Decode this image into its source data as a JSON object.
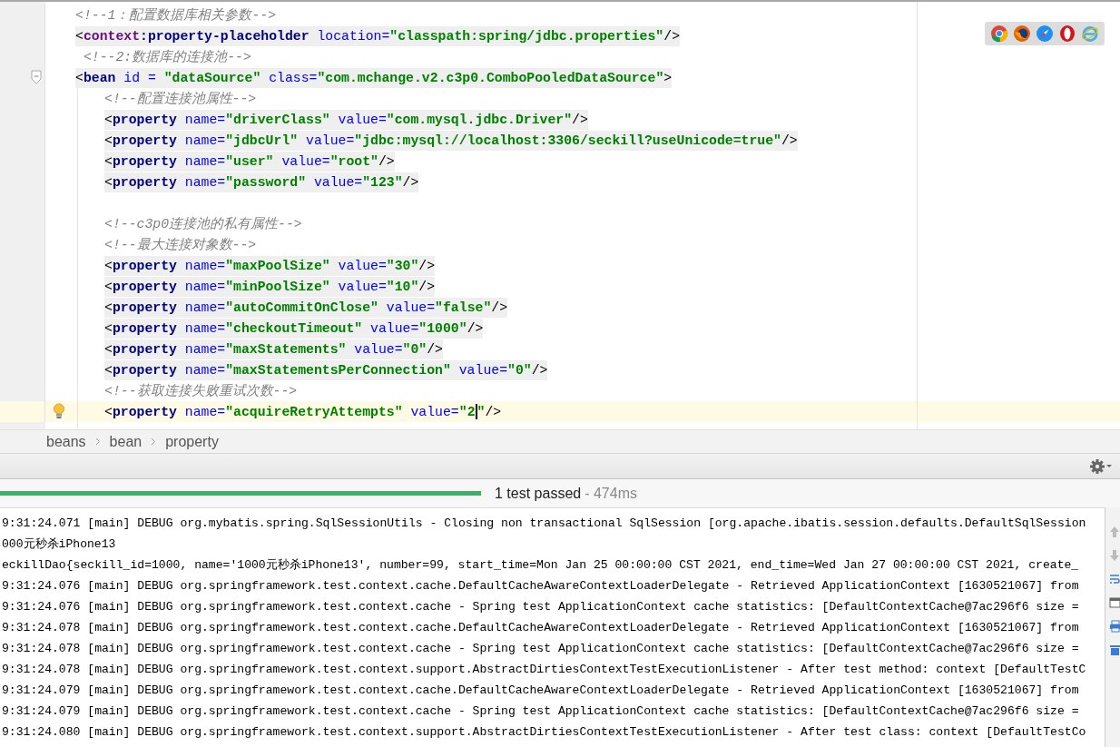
{
  "editor": {
    "lines": [
      {
        "kind": "comment",
        "tokens": [
          {
            "kind": "comment",
            "text": "<!--1：配置数据库相关参数-->"
          }
        ]
      },
      {
        "kind": "tag",
        "tokens": [
          {
            "kind": "punct",
            "text": "<"
          },
          {
            "kind": "ns",
            "text": "context"
          },
          {
            "kind": "tag",
            "text": ":property-placeholder"
          },
          {
            "kind": "attr",
            "text": " location="
          },
          {
            "kind": "value",
            "text": "\"classpath:spring/jdbc.properties\""
          },
          {
            "kind": "punct",
            "text": "/>"
          }
        ]
      },
      {
        "kind": "comment",
        "tokens": [
          {
            "kind": "comment",
            "text": " <!--2:数据库的连接池-->"
          }
        ]
      },
      {
        "kind": "tag",
        "tokens": [
          {
            "kind": "punct",
            "text": "<"
          },
          {
            "kind": "tag",
            "text": "bean"
          },
          {
            "kind": "attr",
            "text": " id = "
          },
          {
            "kind": "value",
            "text": "\"dataSource\""
          },
          {
            "kind": "attr",
            "text": " class="
          },
          {
            "kind": "value",
            "text": "\"com.mchange.v2.c3p0.ComboPooledDataSource\""
          },
          {
            "kind": "punct",
            "text": ">"
          }
        ],
        "children": [
          {
            "kind": "comment",
            "tokens": [
              {
                "kind": "comment",
                "text": "<!--配置连接池属性-->"
              }
            ]
          },
          {
            "kind": "tag",
            "tokens": [
              {
                "kind": "punct",
                "text": "<"
              },
              {
                "kind": "tag",
                "text": "property"
              },
              {
                "kind": "attr",
                "text": " name="
              },
              {
                "kind": "value",
                "text": "\"driverClass\""
              },
              {
                "kind": "attr",
                "text": " value="
              },
              {
                "kind": "value",
                "text": "\"com.mysql.jdbc.Driver\""
              },
              {
                "kind": "punct",
                "text": "/>"
              }
            ]
          },
          {
            "kind": "tag",
            "tokens": [
              {
                "kind": "punct",
                "text": "<"
              },
              {
                "kind": "tag",
                "text": "property"
              },
              {
                "kind": "attr",
                "text": " name="
              },
              {
                "kind": "value",
                "text": "\"jdbcUrl\""
              },
              {
                "kind": "attr",
                "text": " value="
              },
              {
                "kind": "value",
                "text": "\"jdbc:mysql://localhost:3306/seckill?useUnicode=true\""
              },
              {
                "kind": "punct",
                "text": "/>"
              }
            ]
          },
          {
            "kind": "tag",
            "tokens": [
              {
                "kind": "punct",
                "text": "<"
              },
              {
                "kind": "tag",
                "text": "property"
              },
              {
                "kind": "attr",
                "text": " name="
              },
              {
                "kind": "value",
                "text": "\"user\""
              },
              {
                "kind": "attr",
                "text": " value="
              },
              {
                "kind": "value",
                "text": "\"root\""
              },
              {
                "kind": "punct",
                "text": "/>"
              }
            ]
          },
          {
            "kind": "tag",
            "tokens": [
              {
                "kind": "punct",
                "text": "<"
              },
              {
                "kind": "tag",
                "text": "property"
              },
              {
                "kind": "attr",
                "text": " name="
              },
              {
                "kind": "value",
                "text": "\"password\""
              },
              {
                "kind": "attr",
                "text": " value="
              },
              {
                "kind": "value",
                "text": "\"123\""
              },
              {
                "kind": "punct",
                "text": "/>"
              }
            ]
          },
          {
            "kind": "blank"
          },
          {
            "kind": "comment",
            "tokens": [
              {
                "kind": "comment",
                "text": "<!--c3p0连接池的私有属性-->"
              }
            ]
          },
          {
            "kind": "comment",
            "tokens": [
              {
                "kind": "comment",
                "text": "<!--最大连接对象数-->"
              }
            ]
          },
          {
            "kind": "tag",
            "tokens": [
              {
                "kind": "punct",
                "text": "<"
              },
              {
                "kind": "tag",
                "text": "property"
              },
              {
                "kind": "attr",
                "text": " name="
              },
              {
                "kind": "value",
                "text": "\"maxPoolSize\""
              },
              {
                "kind": "attr",
                "text": " value="
              },
              {
                "kind": "value",
                "text": "\"30\""
              },
              {
                "kind": "punct",
                "text": "/>"
              }
            ]
          },
          {
            "kind": "tag",
            "tokens": [
              {
                "kind": "punct",
                "text": "<"
              },
              {
                "kind": "tag",
                "text": "property"
              },
              {
                "kind": "attr",
                "text": " name="
              },
              {
                "kind": "value",
                "text": "\"minPoolSize\""
              },
              {
                "kind": "attr",
                "text": " value="
              },
              {
                "kind": "value",
                "text": "\"10\""
              },
              {
                "kind": "punct",
                "text": "/>"
              }
            ]
          },
          {
            "kind": "tag",
            "tokens": [
              {
                "kind": "punct",
                "text": "<"
              },
              {
                "kind": "tag",
                "text": "property"
              },
              {
                "kind": "attr",
                "text": " name="
              },
              {
                "kind": "value",
                "text": "\"autoCommitOnClose\""
              },
              {
                "kind": "attr",
                "text": " value="
              },
              {
                "kind": "value",
                "text": "\"false\""
              },
              {
                "kind": "punct",
                "text": "/>"
              }
            ]
          },
          {
            "kind": "tag",
            "tokens": [
              {
                "kind": "punct",
                "text": "<"
              },
              {
                "kind": "tag",
                "text": "property"
              },
              {
                "kind": "attr",
                "text": " name="
              },
              {
                "kind": "value",
                "text": "\"checkoutTimeout\""
              },
              {
                "kind": "attr",
                "text": " value="
              },
              {
                "kind": "value",
                "text": "\"1000\""
              },
              {
                "kind": "punct",
                "text": "/>"
              }
            ]
          },
          {
            "kind": "tag",
            "tokens": [
              {
                "kind": "punct",
                "text": "<"
              },
              {
                "kind": "tag",
                "text": "property"
              },
              {
                "kind": "attr",
                "text": " name="
              },
              {
                "kind": "value",
                "text": "\"maxStatements\""
              },
              {
                "kind": "attr",
                "text": " value="
              },
              {
                "kind": "value",
                "text": "\"0\""
              },
              {
                "kind": "punct",
                "text": "/>"
              }
            ]
          },
          {
            "kind": "tag",
            "tokens": [
              {
                "kind": "punct",
                "text": "<"
              },
              {
                "kind": "tag",
                "text": "property"
              },
              {
                "kind": "attr",
                "text": " name="
              },
              {
                "kind": "value",
                "text": "\"maxStatementsPerConnection\""
              },
              {
                "kind": "attr",
                "text": " value="
              },
              {
                "kind": "value",
                "text": "\"0\""
              },
              {
                "kind": "punct",
                "text": "/>"
              }
            ]
          },
          {
            "kind": "comment",
            "tokens": [
              {
                "kind": "comment",
                "text": "<!--获取连接失败重试次数-->"
              }
            ]
          },
          {
            "kind": "current",
            "tokens": [
              {
                "kind": "punct",
                "text": "<"
              },
              {
                "kind": "tag",
                "text": "property"
              },
              {
                "kind": "attr",
                "text": " name="
              },
              {
                "kind": "value",
                "text": "\"acquireRetryAttempts\""
              },
              {
                "kind": "attr",
                "text": " value="
              },
              {
                "kind": "value",
                "text": "\"2"
              },
              {
                "kind": "caret"
              },
              {
                "kind": "value",
                "text": "\""
              },
              {
                "kind": "punct",
                "text": "/>"
              }
            ]
          }
        ]
      }
    ]
  },
  "breadcrumbs": [
    "beans",
    "bean",
    "property"
  ],
  "test_run": {
    "level": 1,
    "summary": "1 test passed",
    "duration": "- 474ms"
  },
  "console": {
    "lines": [
      "9:31:24.071 [main] DEBUG org.mybatis.spring.SqlSessionUtils - Closing non transactional SqlSession [org.apache.ibatis.session.defaults.DefaultSqlSession",
      "000元秒杀iPhone13",
      "eckillDao{seckill_id=1000, name='1000元秒杀iPhone13', number=99, start_time=Mon Jan 25 00:00:00 CST 2021, end_time=Wed Jan 27 00:00:00 CST 2021, create_",
      "9:31:24.076 [main] DEBUG org.springframework.test.context.cache.DefaultCacheAwareContextLoaderDelegate - Retrieved ApplicationContext [1630521067] from",
      "9:31:24.076 [main] DEBUG org.springframework.test.context.cache - Spring test ApplicationContext cache statistics: [DefaultContextCache@7ac296f6 size =",
      "9:31:24.078 [main] DEBUG org.springframework.test.context.cache.DefaultCacheAwareContextLoaderDelegate - Retrieved ApplicationContext [1630521067] from",
      "9:31:24.078 [main] DEBUG org.springframework.test.context.cache - Spring test ApplicationContext cache statistics: [DefaultContextCache@7ac296f6 size =",
      "9:31:24.078 [main] DEBUG org.springframework.test.context.support.AbstractDirtiesContextTestExecutionListener - After test method: context [DefaultTestC",
      "9:31:24.079 [main] DEBUG org.springframework.test.context.cache.DefaultCacheAwareContextLoaderDelegate - Retrieved ApplicationContext [1630521067] from",
      "9:31:24.079 [main] DEBUG org.springframework.test.context.cache - Spring test ApplicationContext cache statistics: [DefaultContextCache@7ac296f6 size =",
      "9:31:24.080 [main] DEBUG org.springframework.test.context.support.AbstractDirtiesContextTestExecutionListener - After test class: context [DefaultTestCo"
    ]
  }
}
